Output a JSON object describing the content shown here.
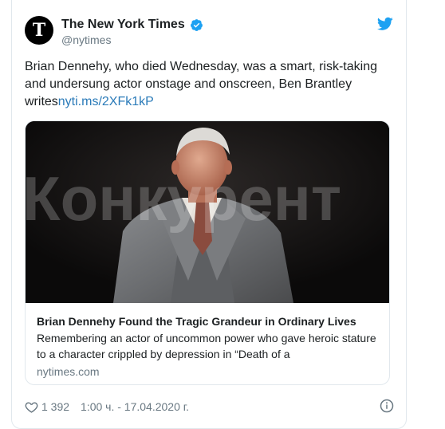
{
  "account": {
    "display_name": "The New York Times",
    "handle": "@nytimes",
    "avatar_letter": "T",
    "verified": true
  },
  "tweet": {
    "text": "Brian Dennehy, who died Wednesday, was a smart, risk-taking and undersung actor onstage and onscreen, Ben Brantley writes",
    "link": "nyti.ms/2XFk1kP"
  },
  "card": {
    "watermark": "Конкурент",
    "title": "Brian Dennehy Found the Tragic Grandeur in Ordinary Lives",
    "description": "Remembering an actor of uncommon power who gave heroic stature to a character crippled by depression in “Death of a",
    "domain": "nytimes.com"
  },
  "footer": {
    "likes": "1 392",
    "timestamp": "1:00 ч. - 17.04.2020 г."
  },
  "colors": {
    "accent": "#1da1f2",
    "link": "#2b7bb9",
    "muted": "#697882",
    "border": "#e1e8ed"
  },
  "icons": [
    "nyt-logo-icon",
    "verified-badge-icon",
    "twitter-bird-icon",
    "heart-icon",
    "info-icon"
  ]
}
